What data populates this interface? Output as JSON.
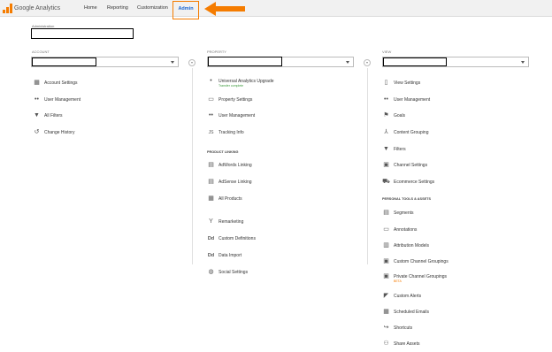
{
  "header": {
    "product": "Google Analytics",
    "nav": [
      "Home",
      "Reporting",
      "Customization",
      "Admin"
    ]
  },
  "colors": {
    "accent": "#f57c00",
    "link": "#1a66d2"
  },
  "page": {
    "title": "Administration"
  },
  "account": {
    "label": "ACCOUNT",
    "items": [
      {
        "label": "Account Settings",
        "icon": "building-icon"
      },
      {
        "label": "User Management",
        "icon": "users-icon"
      },
      {
        "label": "All Filters",
        "icon": "filter-icon"
      },
      {
        "label": "Change History",
        "icon": "history-icon"
      }
    ]
  },
  "property": {
    "label": "PROPERTY",
    "upgrade": {
      "label": "Universal Analytics Upgrade",
      "status": "Transfer complete"
    },
    "items": [
      {
        "label": "Property Settings",
        "icon": "settings-icon"
      },
      {
        "label": "User Management",
        "icon": "users-icon"
      },
      {
        "label": "Tracking Info",
        "icon": "js-icon"
      }
    ],
    "linking_title": "PRODUCT LINKING",
    "linking": [
      {
        "label": "AdWords Linking",
        "icon": "adwords-icon"
      },
      {
        "label": "AdSense Linking",
        "icon": "adsense-icon"
      },
      {
        "label": "All Products",
        "icon": "products-icon"
      }
    ],
    "more": [
      {
        "label": "Remarketing",
        "icon": "remarketing-icon"
      },
      {
        "label": "Custom Definitions",
        "icon": "dd-icon"
      },
      {
        "label": "Data Import",
        "icon": "dd-icon"
      },
      {
        "label": "Social Settings",
        "icon": "globe-icon"
      }
    ]
  },
  "view": {
    "label": "VIEW",
    "items": [
      {
        "label": "View Settings",
        "icon": "document-icon"
      },
      {
        "label": "User Management",
        "icon": "users-icon"
      },
      {
        "label": "Goals",
        "icon": "flag-icon"
      },
      {
        "label": "Content Grouping",
        "icon": "person-icon"
      },
      {
        "label": "Filters",
        "icon": "filter-icon"
      },
      {
        "label": "Channel Settings",
        "icon": "channel-icon"
      },
      {
        "label": "Ecommerce Settings",
        "icon": "cart-icon"
      }
    ],
    "personal_title": "PERSONAL TOOLS & ASSETS",
    "personal": [
      {
        "label": "Segments",
        "icon": "segments-icon"
      },
      {
        "label": "Annotations",
        "icon": "annotations-icon"
      },
      {
        "label": "Attribution Models",
        "icon": "bars-icon"
      },
      {
        "label": "Custom Channel Groupings",
        "icon": "channel-icon"
      },
      {
        "label": "Private Channel Groupings",
        "badge": "BETA",
        "icon": "channel-icon"
      },
      {
        "label": "Custom Alerts",
        "icon": "megaphone-icon"
      },
      {
        "label": "Scheduled Emails",
        "icon": "calendar-icon"
      },
      {
        "label": "Shortcuts",
        "icon": "shortcut-icon"
      },
      {
        "label": "Share Assets",
        "icon": "share-icon"
      }
    ]
  }
}
